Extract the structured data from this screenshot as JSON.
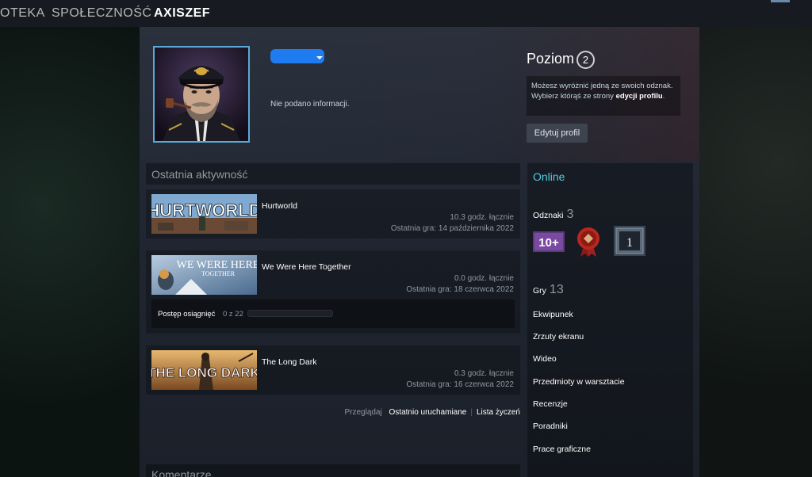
{
  "topnav": {
    "items": [
      "OTEKA",
      "SPOŁECZNOŚĆ",
      "AXISZEF"
    ],
    "active_index": 2
  },
  "profile": {
    "summary": "Nie podano informacji.",
    "level_label": "Poziom",
    "level_value": "2",
    "badge_hint_pre": "Możesz wyróżnić jedną ze swoich odznak. Wybierz którąś ze strony ",
    "badge_hint_link": "edycji profilu",
    "badge_hint_post": ".",
    "edit_button": "Edytuj profil"
  },
  "activity": {
    "header": "Ostatnia aktywność",
    "games": [
      {
        "name": "Hurtworld",
        "capsule_text": "HURTWORLD",
        "hours": "10.3 godz. łącznie",
        "last_played": "Ostatnia gra: 14 października 2022"
      },
      {
        "name": "We Were Here Together",
        "capsule_text": "WE WERE HERE",
        "capsule_subtext": "TOGETHER",
        "hours": "0.0 godz. łącznie",
        "last_played": "Ostatnia gra: 18 czerwca 2022",
        "achievement_label": "Postęp osiągnięć",
        "achievement_count": "0 z 22",
        "achievement_progress": 0
      },
      {
        "name": "The Long Dark",
        "capsule_text": "THE LONG DARK",
        "hours": "0.3 godz. łącznie",
        "last_played": "Ostatnia gra: 16 czerwca 2022"
      }
    ],
    "browse_label": "Przeglądaj",
    "browse_recent": "Ostatnio uruchamiane",
    "browse_wishlist": "Lista życzeń"
  },
  "comments": {
    "header": "Komentarze"
  },
  "sidebar": {
    "status": "Online",
    "badges_label": "Odznaki",
    "badges_count": "3",
    "badge_level_text": "10+",
    "badge_box_text": "1",
    "games_label": "Gry",
    "games_count": "13",
    "links": [
      "Ekwipunek",
      "Zrzuty ekranu",
      "Wideo",
      "Przedmioty w warsztacie",
      "Recenzje",
      "Poradniki",
      "Prace graficzne"
    ]
  }
}
